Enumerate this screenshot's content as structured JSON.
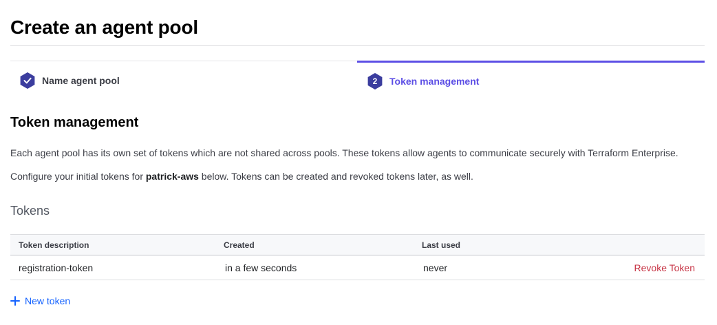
{
  "page": {
    "title": "Create an agent pool"
  },
  "steps": [
    {
      "label": "Name agent pool",
      "state": "complete",
      "icon": "check-icon"
    },
    {
      "label": "Token management",
      "number": "2",
      "state": "active"
    }
  ],
  "section": {
    "title": "Token management",
    "description": "Each agent pool has its own set of tokens which are not shared across pools. These tokens allow agents to communicate securely with Terraform Enterprise.",
    "config_prefix": "Configure your initial tokens for ",
    "pool_name": "patrick-aws",
    "config_suffix": " below. Tokens can be created and revoked tokens later, as well."
  },
  "tokens": {
    "heading": "Tokens",
    "columns": [
      "Token description",
      "Created",
      "Last used"
    ],
    "rows": [
      {
        "description": "registration-token",
        "created": "in a few seconds",
        "last_used": "never",
        "action": "Revoke Token"
      }
    ],
    "new_token_label": "New token"
  },
  "colors": {
    "accent": "#5c4ee5",
    "step_badge": "#3b3d9e",
    "link": "#1563ff",
    "danger": "#c73445"
  }
}
